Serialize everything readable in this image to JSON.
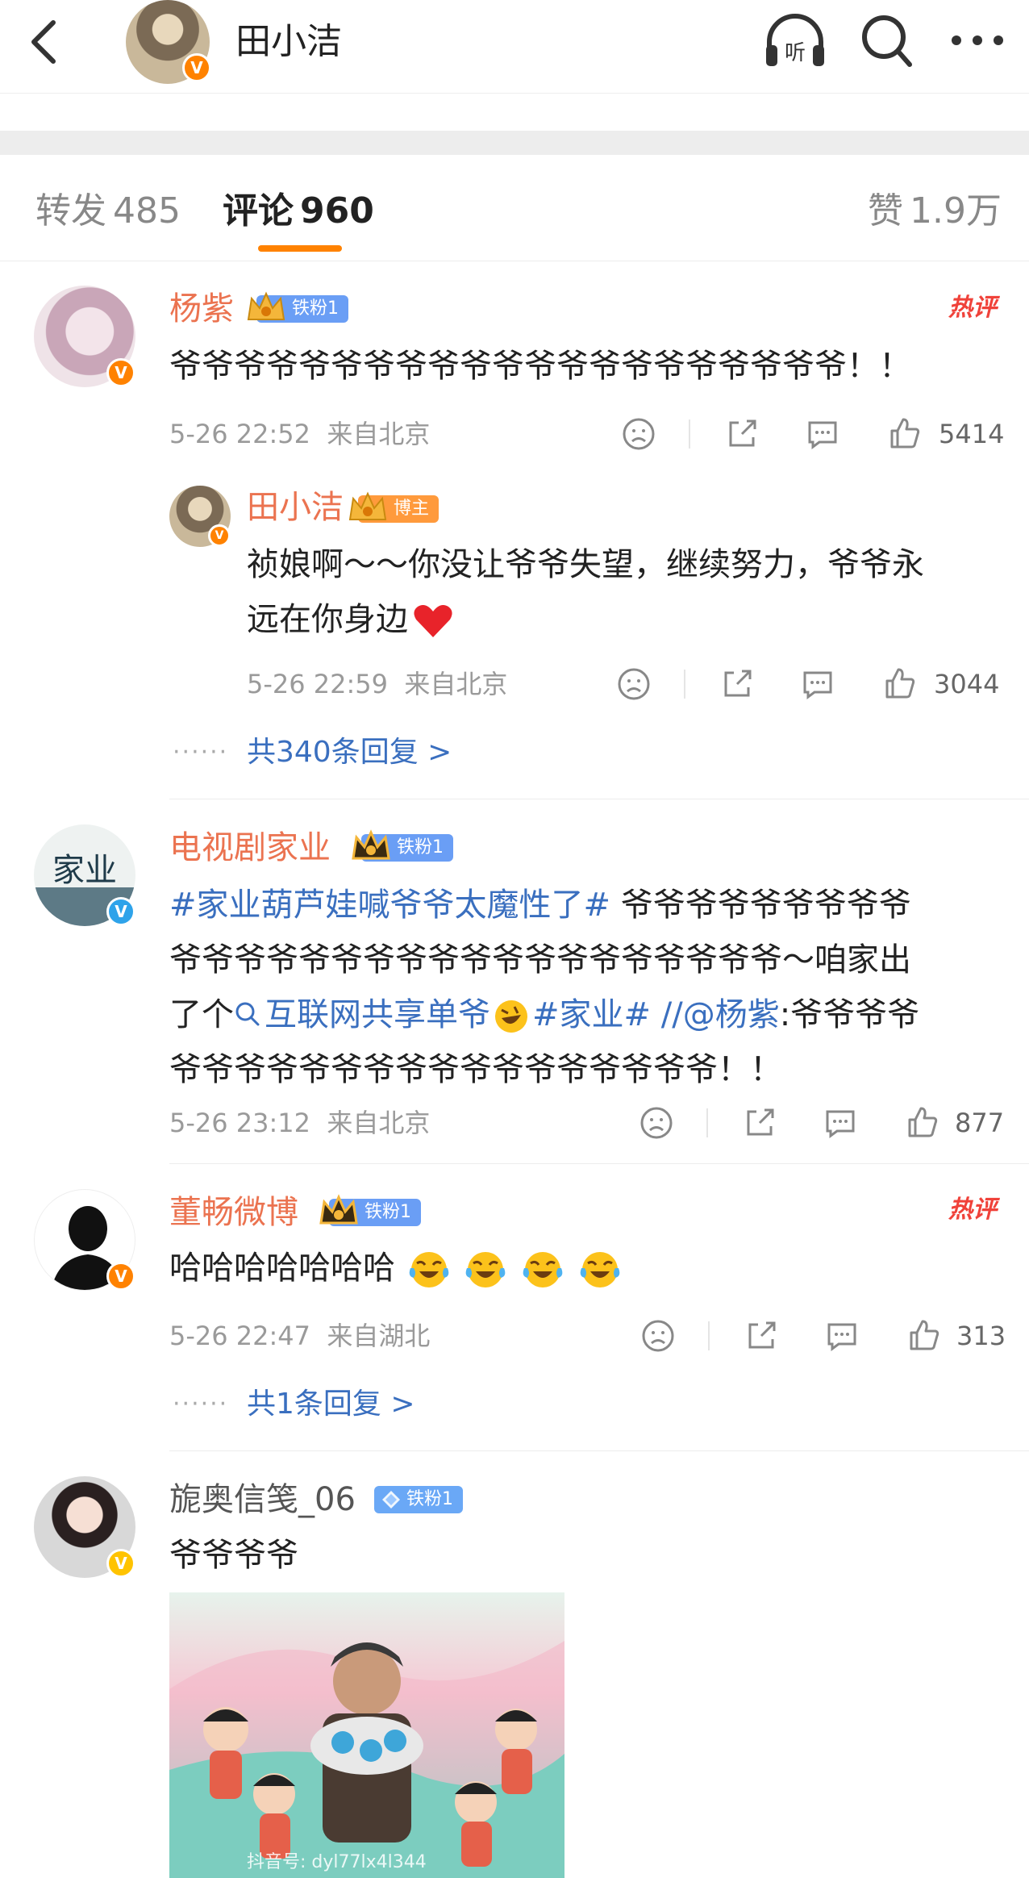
{
  "header": {
    "title": "田小洁"
  },
  "tabs": {
    "repost_label": "转发",
    "repost_count": "485",
    "comment_label": "评论",
    "comment_count": "960",
    "like_label": "赞",
    "like_count": "1.9万"
  },
  "comments": [
    {
      "user": "杨紫",
      "fan_badge": "铁粉1",
      "hot": "热评",
      "text": "爷爷爷爷爷爷爷爷爷爷爷爷爷爷爷爷爷爷爷爷爷！！",
      "time": "5-26 22:52",
      "location": "来自北京",
      "likes": "5414",
      "reply": {
        "user": "田小洁",
        "badge": "博主",
        "text_line1": "祯娘啊～～你没让爷爷失望，继续努力，爷爷永",
        "text_line2": "远在你身边",
        "time": "5-26 22:59",
        "location": "来自北京",
        "likes": "3044"
      },
      "more_replies": "共340条回复 >"
    },
    {
      "user": "电视剧家业",
      "fan_badge": "铁粉1",
      "text_hashtag1": "#家业葫芦娃喊爷爷太魔性了#",
      "text_part1": " 爷爷爷爷爷爷爷爷爷",
      "text_line2": "爷爷爷爷爷爷爷爷爷爷爷爷爷爷爷爷爷爷爷～咱家出",
      "text_line3_pre": "了个",
      "text_search_link": "互联网共享单爷",
      "text_hashtag2": "#家业#",
      "text_mention": " //@杨紫",
      "text_line3_post": ":爷爷爷爷",
      "text_line4": "爷爷爷爷爷爷爷爷爷爷爷爷爷爷爷爷爷！！",
      "time": "5-26 23:12",
      "location": "来自北京",
      "likes": "877"
    },
    {
      "user": "董畅微博",
      "fan_badge": "铁粉1",
      "hot": "热评",
      "text": "哈哈哈哈哈哈哈",
      "time": "5-26 22:47",
      "location": "来自湖北",
      "likes": "313",
      "more_replies": "共1条回复 >"
    },
    {
      "user": "旎奥信笺_06",
      "fan_badge": "铁粉1",
      "text": "爷爷爷爷"
    }
  ],
  "media": {
    "watermark": "抖音号: dyl77lx4l344"
  },
  "colors": {
    "accent": "#ff8200",
    "username": "#eb7350",
    "link": "#3a6fbf",
    "hot": "#f0423a"
  }
}
